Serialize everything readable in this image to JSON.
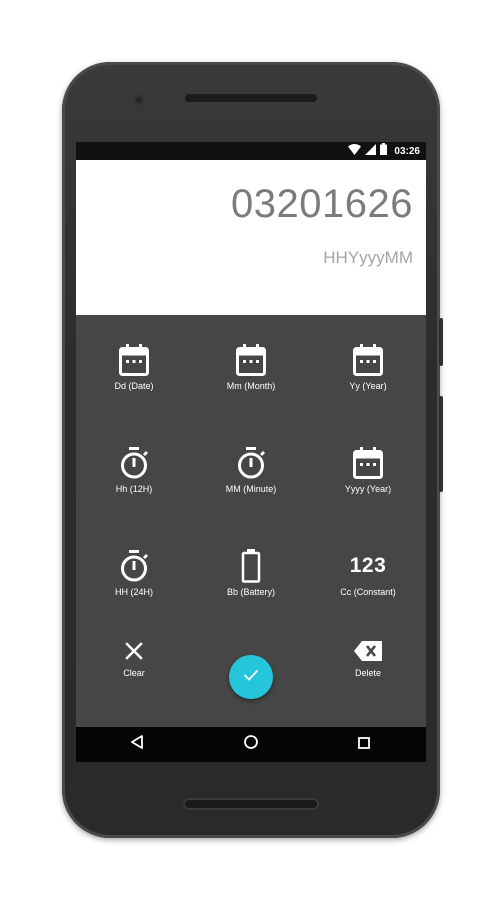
{
  "status_bar": {
    "time": "03:26"
  },
  "display": {
    "value": "03201626",
    "format": "HHYyyyMM"
  },
  "keys": [
    {
      "id": "date",
      "label": "Dd (Date)",
      "icon": "calendar-icon"
    },
    {
      "id": "month",
      "label": "Mm (Month)",
      "icon": "calendar-icon"
    },
    {
      "id": "year-short",
      "label": "Yy (Year)",
      "icon": "calendar-icon"
    },
    {
      "id": "hour-12",
      "label": "Hh (12H)",
      "icon": "stopwatch-icon"
    },
    {
      "id": "minute",
      "label": "MM (Minute)",
      "icon": "stopwatch-icon"
    },
    {
      "id": "year-long",
      "label": "Yyyy (Year)",
      "icon": "calendar-icon"
    },
    {
      "id": "hour-24",
      "label": "HH (24H)",
      "icon": "stopwatch-icon"
    },
    {
      "id": "battery",
      "label": "Bb (Battery)",
      "icon": "battery-icon"
    },
    {
      "id": "constant",
      "label": "Cc (Constant)",
      "icon": "numeric-icon",
      "glyph": "123"
    }
  ],
  "actions": {
    "clear_label": "Clear",
    "delete_label": "Delete"
  },
  "colors": {
    "accent": "#26c6da",
    "keypad_bg": "#464646",
    "display_bg": "#ffffff",
    "display_text": "#7b7b7b"
  }
}
